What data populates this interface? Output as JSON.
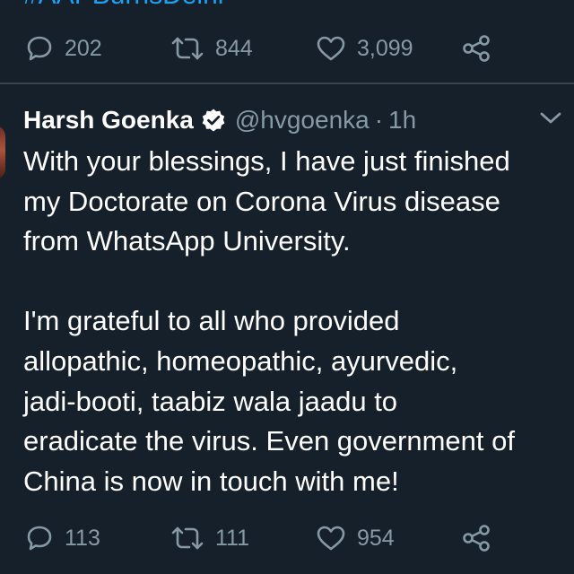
{
  "previous_tweet": {
    "hashtag": "#AAPBurnsDelhi",
    "actions": {
      "replies": "202",
      "retweets": "844",
      "likes": "3,099"
    }
  },
  "tweet": {
    "author_name": "Harsh Goenka",
    "handle": "@hvgoenka",
    "separator": "·",
    "time": "1h",
    "lines": [
      "With your blessings, I have just finished",
      "my Doctorate on Corona Virus disease",
      "from WhatsApp University.",
      "",
      "I'm grateful to all who provided",
      "allopathic, homeopathic, ayurvedic,",
      "jadi-booti, taabiz wala jaadu to",
      "eradicate the virus. Even government of",
      "China is now in touch with me!"
    ],
    "actions": {
      "replies": "113",
      "retweets": "111",
      "likes": "954"
    }
  },
  "colors": {
    "background": "#15202b",
    "text_primary": "#ffffff",
    "text_secondary": "#8899a6",
    "accent": "#1da1f2",
    "divider": "#38444d"
  },
  "icons": [
    "reply-icon",
    "retweet-icon",
    "like-icon",
    "share-icon",
    "verified-badge-icon",
    "chevron-down-icon"
  ]
}
